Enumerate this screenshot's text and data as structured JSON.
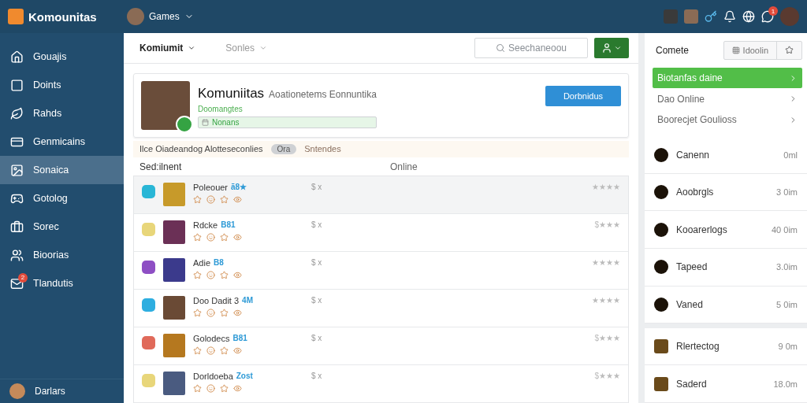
{
  "topbar": {
    "logo": "Komounitas",
    "menu": "Games",
    "notification_badge": "1"
  },
  "sidebar": {
    "items": [
      {
        "label": "Gouajis",
        "selected": false
      },
      {
        "label": "Doints",
        "selected": false
      },
      {
        "label": "Rahds",
        "selected": false
      },
      {
        "label": "Genmicains",
        "selected": false
      },
      {
        "label": "Sonaica",
        "selected": true
      },
      {
        "label": "Gotolog",
        "selected": false
      },
      {
        "label": "Sorec",
        "selected": false
      },
      {
        "label": "Bioorias",
        "selected": false
      },
      {
        "label": "Tlandutis",
        "selected": false,
        "badge": "2"
      }
    ],
    "footer": {
      "label": "Darlars"
    }
  },
  "toolbar": {
    "community_menu": "Komiumit",
    "sort_menu": "Sonles",
    "search": {
      "placeholder": "Seechaneoou"
    }
  },
  "profile": {
    "title": "Komuniitas",
    "subtitle": "Aoationetems Eonnuntika",
    "status": "Doomangtes",
    "tag": "Nonans",
    "button": "Dorbnidus"
  },
  "notice": {
    "text": "Ilce Oiadeandog Alotteseconlies",
    "pill": "Ora",
    "link": "Sntendes"
  },
  "table": {
    "columns": [
      "Sed:ilnent",
      "Online"
    ],
    "rows": [
      {
        "name": "Poleouer",
        "tag": "ã8★",
        "price": "$ x",
        "rating": "★★★★",
        "selected": true,
        "color": "#29b6d6"
      },
      {
        "name": "Rdcke",
        "tag": "B81",
        "price": "$ x",
        "rating": "$★★★",
        "selected": false,
        "color": "#e8d67a"
      },
      {
        "name": "Adie",
        "tag": "B8",
        "price": "$ x",
        "rating": "★★★★",
        "selected": false,
        "color": "#8e4fc4"
      },
      {
        "name": "Doo Dadit 3",
        "tag": "4M",
        "price": "$ x",
        "rating": "★★★★",
        "selected": false,
        "color": "#2eaee0"
      },
      {
        "name": "Golodecs",
        "tag": "B81",
        "price": "$ x",
        "rating": "$★★★",
        "selected": false,
        "color": "#e06a5a"
      },
      {
        "name": "Dorldoeba",
        "tag": "Zost",
        "price": "$ x",
        "rating": "$★★★",
        "selected": false,
        "color": "#e8d67a"
      }
    ]
  },
  "panel": {
    "title": "Comete",
    "segment": "Idoolin",
    "menu": [
      {
        "label": "Biotanfas daine",
        "selected": true
      },
      {
        "label": "Dao Online",
        "selected": false
      },
      {
        "label": "Boorecjet Goulioss",
        "selected": false
      }
    ],
    "friends": [
      {
        "name": "Canenn",
        "time": "0ml"
      },
      {
        "name": "Aoobrgls",
        "time": "3 0im"
      },
      {
        "name": "Kooarerlogs",
        "time": "40 0im"
      },
      {
        "name": "Tapeed",
        "time": "3.0im"
      },
      {
        "name": "Vaned",
        "time": "5 0im"
      }
    ],
    "more": [
      {
        "name": "Rlertectog",
        "time": "9 0m"
      },
      {
        "name": "Saderd",
        "time": "18.0m"
      }
    ]
  }
}
